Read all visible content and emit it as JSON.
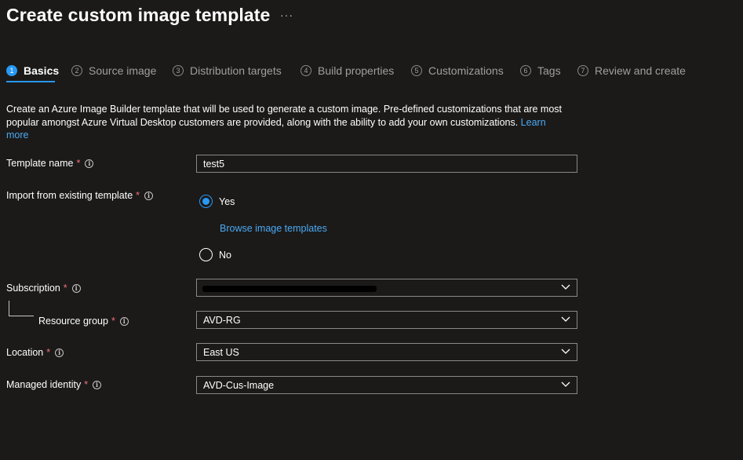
{
  "header": {
    "title": "Create custom image template",
    "more_label": "···"
  },
  "tabs": [
    {
      "num": "1",
      "label": "Basics",
      "active": true
    },
    {
      "num": "2",
      "label": "Source image"
    },
    {
      "num": "3",
      "label": "Distribution targets"
    },
    {
      "num": "4",
      "label": "Build properties"
    },
    {
      "num": "5",
      "label": "Customizations"
    },
    {
      "num": "6",
      "label": "Tags"
    },
    {
      "num": "7",
      "label": "Review and create"
    }
  ],
  "description": {
    "text": "Create an Azure Image Builder template that will be used to generate a custom image. Pre-defined customizations that are most popular amongst Azure Virtual Desktop customers are provided, along with the ability to add your own customizations. ",
    "link_text": "Learn more"
  },
  "form": {
    "template_name": {
      "label": "Template name",
      "value": "test5"
    },
    "import_existing": {
      "label": "Import from existing template",
      "yes_label": "Yes",
      "no_label": "No",
      "selected": "Yes",
      "browse_link": "Browse image templates"
    },
    "subscription": {
      "label": "Subscription",
      "value": ""
    },
    "resource_group": {
      "label": "Resource group",
      "value": "AVD-RG"
    },
    "location": {
      "label": "Location",
      "value": "East US"
    },
    "managed_identity": {
      "label": "Managed identity",
      "value": "AVD-Cus-Image"
    },
    "required_marker": "*",
    "info_icon_glyph": "i"
  },
  "colors": {
    "accent": "#2899f5",
    "link": "#4ba9f2",
    "required": "#f1707b",
    "background": "#1b1a19"
  },
  "icons": [
    "info-icon",
    "chevron-down-icon",
    "radio-button"
  ]
}
